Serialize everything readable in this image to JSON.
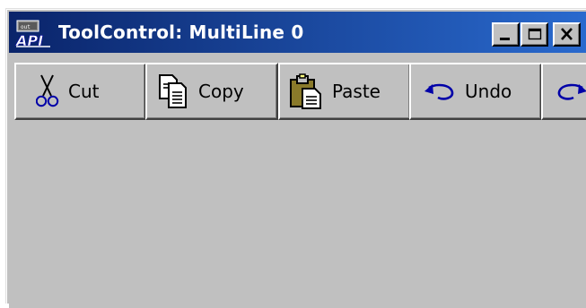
{
  "window": {
    "title": "ToolControl: MultiLine 0",
    "icon": "api-app-icon",
    "icon_text": "API",
    "controls": [
      "minimize-icon",
      "maximize-icon",
      "close-icon"
    ]
  },
  "toolbar": {
    "buttons": [
      {
        "label": "Cut",
        "icon": "scissors-icon"
      },
      {
        "label": "Copy",
        "icon": "copy-icon"
      },
      {
        "label": "Paste",
        "icon": "paste-icon"
      },
      {
        "label": "Undo",
        "icon": "undo-icon"
      },
      {
        "label": "",
        "icon": "redo-icon"
      }
    ]
  },
  "colors": {
    "face": "#c0c0c0",
    "title_start": "#0a246a",
    "title_end": "#2a6bd0",
    "title_text": "#ffffff"
  }
}
